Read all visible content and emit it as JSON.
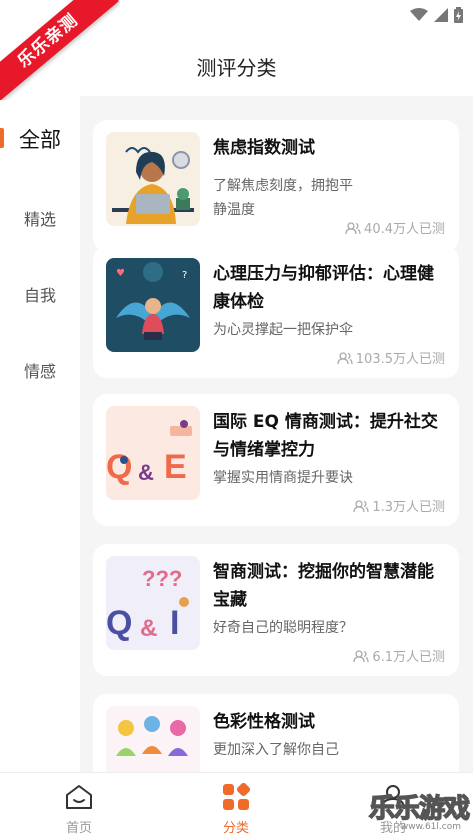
{
  "app": {
    "ribbon_text": "乐乐亲测",
    "title": "测评分类"
  },
  "sidebar": {
    "items": [
      {
        "label": "全部",
        "active": true
      },
      {
        "label": "精选",
        "active": false
      },
      {
        "label": "自我",
        "active": false
      },
      {
        "label": "情感",
        "active": false
      }
    ]
  },
  "tests": [
    {
      "title": "焦虑指数测试",
      "desc": "了解焦虑刻度，拥抱平静温度",
      "count": "40.4万人已测",
      "thumb_icon": "anxious-woman-illustration"
    },
    {
      "title": "心理压力与抑郁评估：心理健康体检",
      "desc": "为心灵撑起一把保护伞",
      "count": "103.5万人已测",
      "thumb_icon": "stressed-person-illustration"
    },
    {
      "title": "国际 EQ 情商测试：提升社交与情绪掌控力",
      "desc": "掌握实用情商提升要诀",
      "count": "1.3万人已测",
      "thumb_icon": "qa-illustration"
    },
    {
      "title": "智商测试：挖掘你的智慧潜能宝藏",
      "desc": "好奇自己的聪明程度？",
      "count": "6.1万人已测",
      "thumb_icon": "question-marks-illustration"
    },
    {
      "title": "色彩性格测试",
      "desc": "更加深入了解你自己",
      "count": "",
      "thumb_icon": "colorful-people-illustration"
    }
  ],
  "tabbar": {
    "tabs": [
      {
        "label": "首页",
        "icon": "home-icon",
        "active": false
      },
      {
        "label": "分类",
        "icon": "category-icon",
        "active": true
      },
      {
        "label": "我的",
        "icon": "profile-icon",
        "active": false
      }
    ]
  },
  "watermark": {
    "text": "乐乐游戏",
    "url": "www.61l.com"
  },
  "colors": {
    "accent": "#f06a2a",
    "ribbon": "#e8182b",
    "content_bg": "#f5f5f5"
  }
}
